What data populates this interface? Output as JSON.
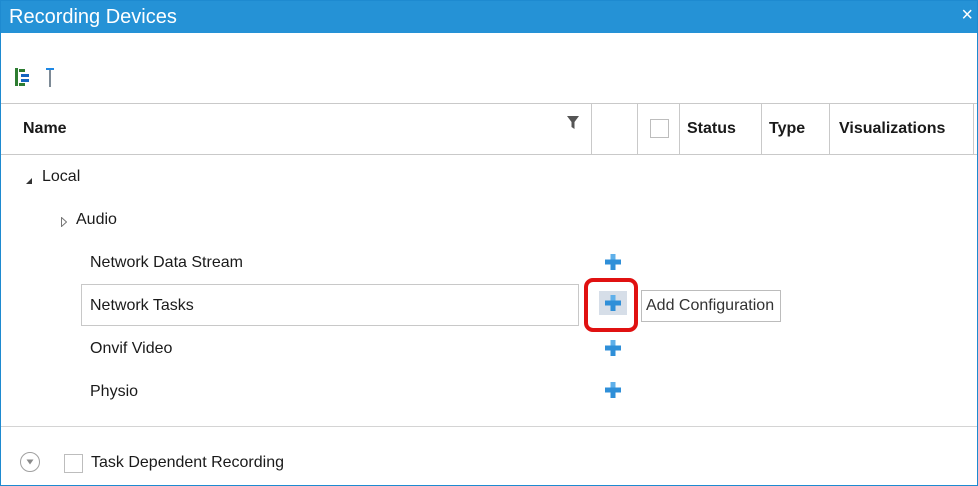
{
  "window": {
    "title": "Recording Devices",
    "close_glyph": "×",
    "accent_color": "#2592d6"
  },
  "toolbar": {
    "buttons": [
      {
        "icon": "tree-view-icon"
      },
      {
        "icon": "pin-icon"
      }
    ]
  },
  "grid": {
    "columns": {
      "name": "Name",
      "status": "Status",
      "type": "Type",
      "visualizations": "Visualizations"
    },
    "rows": [
      {
        "label": "Local",
        "expander": "expanded"
      },
      {
        "label": "Audio",
        "expander": "collapsed"
      },
      {
        "label": "Network Data Stream",
        "action_icon": "add-icon"
      },
      {
        "label": "Network Tasks",
        "action_icon": "add-icon",
        "selected": true
      },
      {
        "label": "Onvif Video",
        "action_icon": "add-icon"
      },
      {
        "label": "Physio",
        "action_icon": "add-icon"
      }
    ],
    "tooltip": "Add Configuration",
    "highlight_color": "#e01111"
  },
  "footer": {
    "checkbox_label": "Task Dependent Recording",
    "checked": false
  }
}
